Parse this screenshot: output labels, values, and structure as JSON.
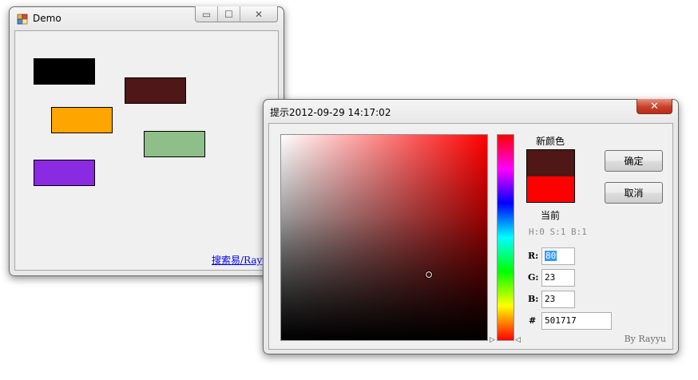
{
  "demo": {
    "title": "Demo",
    "link": "搜索易/Rayyu",
    "rect_colors": [
      "#000000",
      "#4f1717",
      "#ffa500",
      "#8fbf88",
      "#8a2be2"
    ]
  },
  "dialog": {
    "title": "提示2012-09-29 14:17:02",
    "new_color_label": "新颜色",
    "current_label": "当前",
    "new_color": "#501717",
    "current_color": "#ff0000",
    "hsb": "H:0 S:1 B:1",
    "r_label": "R:",
    "g_label": "G:",
    "b_label": "B:",
    "hex_label": "#",
    "r_value": "80",
    "g_value": "23",
    "b_value": "23",
    "hex_value": "501717",
    "ok_label": "确定",
    "cancel_label": "取消",
    "byline": "By Rayyu"
  },
  "icons": {
    "minimize": "minimize-icon",
    "maximize": "maximize-icon",
    "close": "close-icon",
    "app": "app-icon"
  }
}
